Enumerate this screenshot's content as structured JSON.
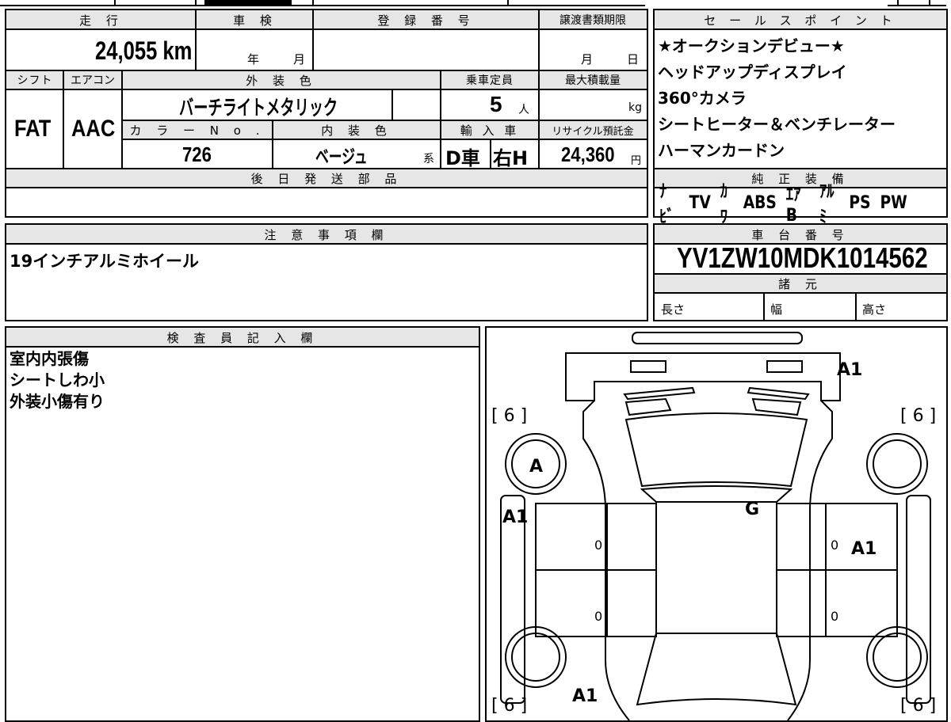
{
  "headers": {
    "mileage": "走 行",
    "inspection": "車 検",
    "registration": "登 録 番 号",
    "transfer_deadline": "譲渡書類期限",
    "sales_points": "セ ー ル ス ポ イ ン ト",
    "shift": "シフト",
    "aircon": "エアコン",
    "exterior_color": "外 装 色",
    "capacity": "乗車定員",
    "max_load": "最大積載量",
    "color_no": "カ ラ ー N o .",
    "interior_color": "内 装 色",
    "import": "輸 入 車",
    "recycle": "リサイクル預託金",
    "later_parts": "後 日 発 送 部 品",
    "genuine_equipment": "純 正 装 備",
    "notes": "注 意 事 項 欄",
    "chassis_no": "車 台 番 号",
    "specs": "諸 元",
    "inspector": "検 査 員 記 入 欄"
  },
  "vehicle": {
    "mileage": "24,055 km",
    "inspection_year_label": "年",
    "inspection_month_label": "月",
    "deadline_month_label": "月",
    "deadline_day_label": "日",
    "shift": "FAT",
    "aircon": "AAC",
    "exterior_color": "バーチライトメタリック",
    "capacity": "5",
    "capacity_unit": "人",
    "max_load_unit": "kg",
    "color_no": "726",
    "interior_color": "ベージュ",
    "interior_suffix": "系",
    "import_type": "D車",
    "steering": "右H",
    "recycle_fee": "24,360",
    "recycle_unit": "円"
  },
  "sales_points": [
    "★オークションデビュー★",
    "ヘッドアップディスプレイ",
    "360°カメラ",
    "シートヒーター＆ベンチレーター",
    "ハーマンカードン"
  ],
  "equipment": [
    "ﾅﾋﾞ",
    "TV",
    "ｶﾜ",
    "ABS",
    "ｴｱB",
    "ｱﾙﾐ",
    "PS",
    "PW"
  ],
  "notes": "19インチアルミホイール",
  "chassis_no": "YV1ZW10MDK1014562",
  "specs": {
    "length": "長さ",
    "width": "幅",
    "height": "高さ"
  },
  "inspector_notes": [
    "室内内張傷",
    "シートしわ小",
    "外装小傷有り"
  ],
  "diagram": {
    "tread_fl": "[ 6 ]",
    "tread_fr": "[ 6 ]",
    "tread_rl": "[ 6 ]",
    "tread_rr": "[ 6 ]",
    "mark_rear_right": "A1",
    "mark_wheel_fl": "A",
    "mark_left_front_door": "A1",
    "mark_roof": "G",
    "mark_right_front_door": "A1",
    "mark_rear_left": "A1",
    "door_lf": "0",
    "door_rf": "0",
    "door_lr": "0",
    "door_rr": "0"
  }
}
